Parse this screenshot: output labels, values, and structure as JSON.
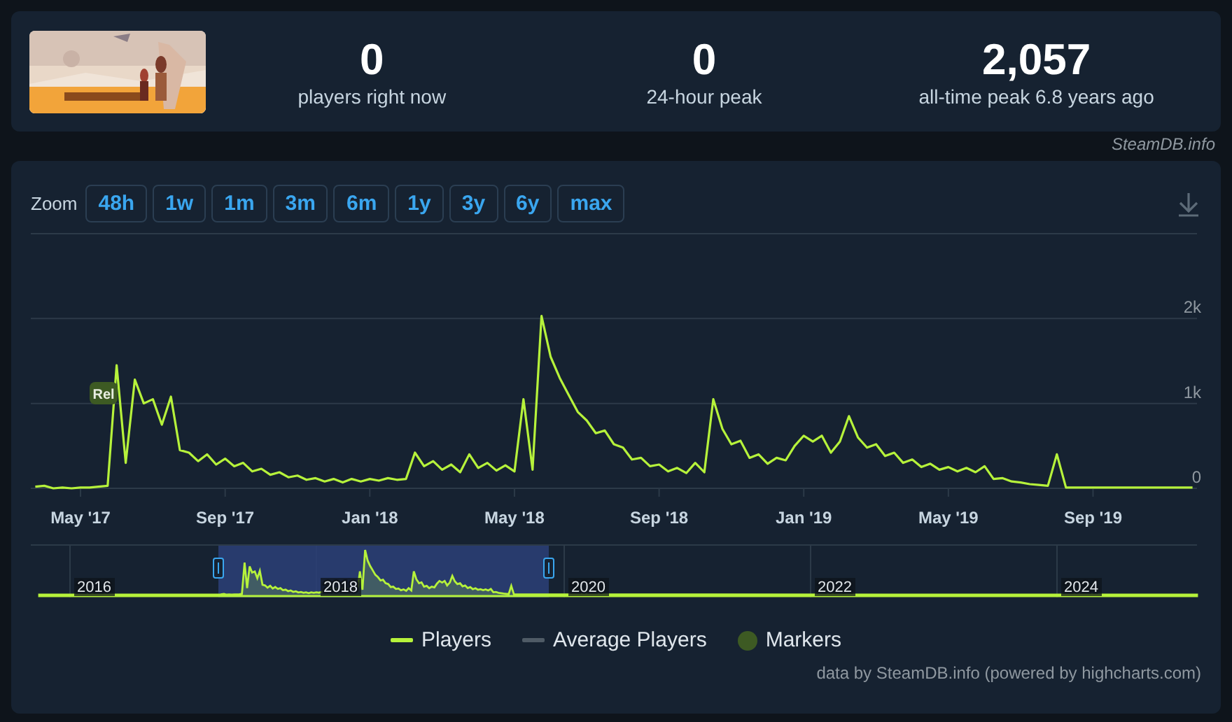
{
  "summary": {
    "stats": [
      {
        "value": "0",
        "label": "players right now"
      },
      {
        "value": "0",
        "label": "24-hour peak"
      },
      {
        "value": "2,057",
        "label": "all-time peak 6.8 years ago"
      }
    ]
  },
  "credit": "SteamDB.info",
  "chart": {
    "zoom_label": "Zoom",
    "zoom_buttons": [
      {
        "label": "48h",
        "selected": false
      },
      {
        "label": "1w",
        "selected": false
      },
      {
        "label": "1m",
        "selected": false
      },
      {
        "label": "3m",
        "selected": false
      },
      {
        "label": "6m",
        "selected": false
      },
      {
        "label": "1y",
        "selected": false
      },
      {
        "label": "3y",
        "selected": false
      },
      {
        "label": "6y",
        "selected": false
      },
      {
        "label": "max",
        "selected": false
      }
    ],
    "chart_data": {
      "type": "line",
      "ylim": [
        0,
        3000
      ],
      "yticks": [
        {
          "value": 0,
          "label": "0"
        },
        {
          "value": 1000,
          "label": "1k"
        },
        {
          "value": 2000,
          "label": "2k"
        }
      ],
      "annotations": [
        "Rel"
      ],
      "categories": [
        null,
        null,
        null,
        null,
        null,
        "May '17",
        null,
        null,
        null,
        null,
        null,
        null,
        null,
        null,
        null,
        null,
        null,
        null,
        null,
        null,
        null,
        "Sep '17",
        null,
        null,
        null,
        null,
        null,
        null,
        null,
        null,
        null,
        null,
        null,
        null,
        null,
        null,
        null,
        "Jan '18",
        null,
        null,
        null,
        null,
        null,
        null,
        null,
        null,
        null,
        null,
        null,
        null,
        null,
        null,
        null,
        "May '18",
        null,
        null,
        null,
        null,
        null,
        null,
        null,
        null,
        null,
        null,
        null,
        null,
        null,
        null,
        null,
        "Sep '18",
        null,
        null,
        null,
        null,
        null,
        null,
        null,
        null,
        null,
        null,
        null,
        null,
        null,
        null,
        null,
        "Jan '19",
        null,
        null,
        null,
        null,
        null,
        null,
        null,
        null,
        null,
        null,
        null,
        null,
        null,
        null,
        null,
        "May '19",
        null,
        null,
        null,
        null,
        null,
        null,
        null,
        null,
        null,
        null,
        null,
        null,
        null,
        null,
        null,
        "Sep '19",
        null,
        null,
        null,
        null,
        null,
        null,
        null,
        null,
        null,
        null,
        null
      ],
      "series": [
        {
          "name": "Players",
          "color": "#b6f23b",
          "values": [
            20,
            30,
            0,
            10,
            0,
            10,
            10,
            20,
            30,
            1450,
            300,
            1280,
            1000,
            1050,
            750,
            1080,
            450,
            420,
            320,
            400,
            280,
            350,
            260,
            300,
            200,
            230,
            160,
            190,
            130,
            150,
            100,
            120,
            80,
            110,
            70,
            110,
            80,
            110,
            90,
            120,
            100,
            110,
            420,
            260,
            320,
            220,
            280,
            190,
            400,
            240,
            300,
            210,
            270,
            200,
            1050,
            220,
            2030,
            1550,
            1300,
            1100,
            900,
            800,
            650,
            680,
            520,
            480,
            340,
            360,
            260,
            280,
            200,
            240,
            180,
            300,
            190,
            1050,
            700,
            520,
            560,
            360,
            400,
            290,
            360,
            330,
            500,
            620,
            550,
            620,
            420,
            550,
            850,
            600,
            480,
            520,
            380,
            420,
            300,
            340,
            250,
            290,
            220,
            250,
            200,
            240,
            190,
            260,
            110,
            120,
            80,
            70,
            50,
            40,
            30,
            400,
            10,
            10,
            10,
            10,
            10,
            10,
            10,
            10,
            10,
            10,
            10,
            10,
            10,
            10,
            10
          ]
        }
      ]
    },
    "navigator_years": [
      "2016",
      "2018",
      "2020",
      "2022",
      "2024"
    ],
    "legend": [
      {
        "label": "Average Players",
        "kind": "line",
        "color": "#4f5b66"
      },
      {
        "label": "Markers",
        "kind": "dot",
        "color": "#3d5a23"
      }
    ],
    "source": "data by SteamDB.info (powered by highcharts.com)"
  }
}
